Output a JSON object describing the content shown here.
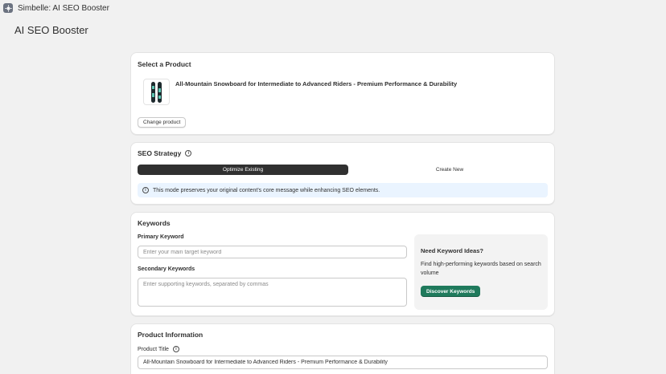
{
  "app": {
    "window_title": "Simbelle: AI SEO Booster",
    "page_title": "AI SEO Booster"
  },
  "product_section": {
    "title": "Select a Product",
    "product_name": "All-Mountain Snowboard for Intermediate to Advanced Riders - Premium Performance & Durability",
    "change_button": "Change product"
  },
  "seo_strategy": {
    "title": "SEO Strategy",
    "tabs": [
      {
        "label": "Optimize Existing",
        "active": true
      },
      {
        "label": "Create New",
        "active": false
      }
    ],
    "info_banner": "This mode preserves your original content's core message while enhancing SEO elements."
  },
  "keywords": {
    "title": "Keywords",
    "primary_label": "Primary Keyword",
    "primary_placeholder": "Enter your main target keyword",
    "secondary_label": "Secondary Keywords",
    "secondary_placeholder": "Enter supporting keywords, separated by commas",
    "ideas": {
      "title": "Need Keyword Ideas?",
      "description": "Find high-performing keywords based on search volume",
      "button": "Discover Keywords"
    }
  },
  "product_info": {
    "title": "Product Information",
    "title_label": "Product Title",
    "title_value": "All-Mountain Snowboard for Intermediate to Advanced Riders - Premium Performance & Durability"
  },
  "icons": {
    "app": "app-logo-icon",
    "info": "info-icon"
  },
  "colors": {
    "accent_green": "#1f7a5c",
    "active_tab": "#303030",
    "info_banner_bg": "#eaf4ff",
    "page_bg": "#f1f1f1"
  }
}
